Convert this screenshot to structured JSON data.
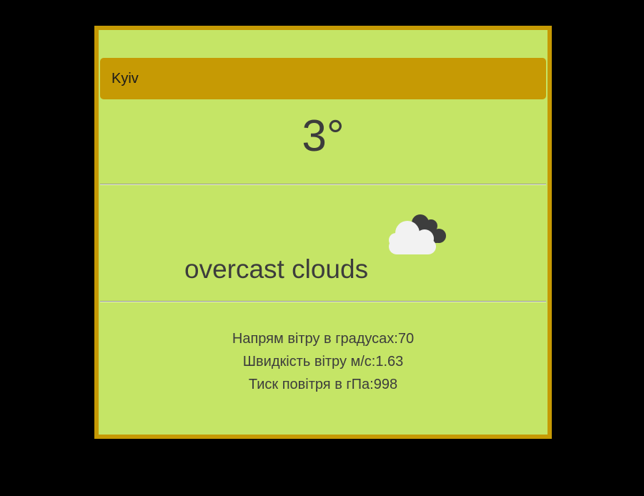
{
  "city": {
    "name": "Kyiv"
  },
  "weather": {
    "temperature": "3°",
    "description": "overcast clouds",
    "icon": "overcast-clouds-icon"
  },
  "details": {
    "wind_direction": "Напрям вітру в градусах:70",
    "wind_speed": "Швидкість вітру м/с:1.63",
    "pressure": "Тиск повітря в гПа:998"
  },
  "colors": {
    "page_background": "#000000",
    "card_background": "#c5e566",
    "accent": "#c69a04",
    "text": "#3c3c3c"
  }
}
